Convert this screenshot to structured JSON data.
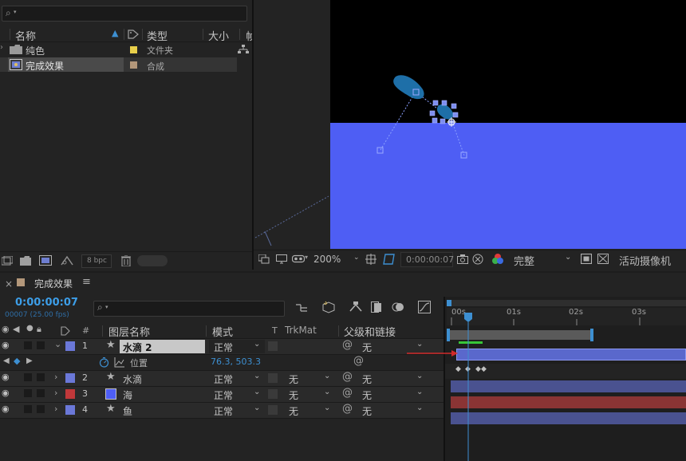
{
  "project": {
    "search_placeholder": "",
    "columns": {
      "name": "名称",
      "type": "类型",
      "size": "大小",
      "more": "帧"
    },
    "items": [
      {
        "name": "纯色",
        "type": "文件夹",
        "label_color": "#e8cf4a",
        "kind": "folder"
      },
      {
        "name": "完成效果",
        "type": "合成",
        "label_color": "#b3977a",
        "kind": "composition"
      }
    ],
    "bit_depth": "8 bpc"
  },
  "viewer": {
    "zoom": "200%",
    "timecode": "0:00:00:07",
    "resolution": "完整",
    "camera": "活动摄像机",
    "colors": {
      "sky": "#000000",
      "water": "#4e5ef4",
      "drop": "#1e6fa8"
    }
  },
  "timeline": {
    "tab_title": "完成效果",
    "current_time": "0:00:00:07",
    "frame_info": "00007 (25.00 fps)",
    "columns": {
      "num": "#",
      "layer_name": "图层名称",
      "mode": "模式",
      "t": "T",
      "trkmat": "TrkMat",
      "parent": "父级和链接"
    },
    "ruler": [
      "00s",
      "01s",
      "02s",
      "03s"
    ],
    "layers": [
      {
        "num": "1",
        "name": "水滴 2",
        "mode": "正常",
        "trkmat": "",
        "parent": "无",
        "color": "#6b78d8",
        "expanded": true,
        "bar": "#5a68cc"
      },
      {
        "num": "2",
        "name": "水滴",
        "mode": "正常",
        "trkmat": "无",
        "parent": "无",
        "color": "#6b78d8",
        "bar": "#4a5290"
      },
      {
        "num": "3",
        "name": "海",
        "mode": "正常",
        "trkmat": "无",
        "parent": "无",
        "color": "#c0383a",
        "bar": "#8a3434"
      },
      {
        "num": "4",
        "name": "鱼",
        "mode": "正常",
        "trkmat": "无",
        "parent": "无",
        "color": "#6b78d8",
        "bar": "#4a5290"
      }
    ],
    "property": {
      "name": "位置",
      "value": "76.3, 503.3"
    }
  }
}
